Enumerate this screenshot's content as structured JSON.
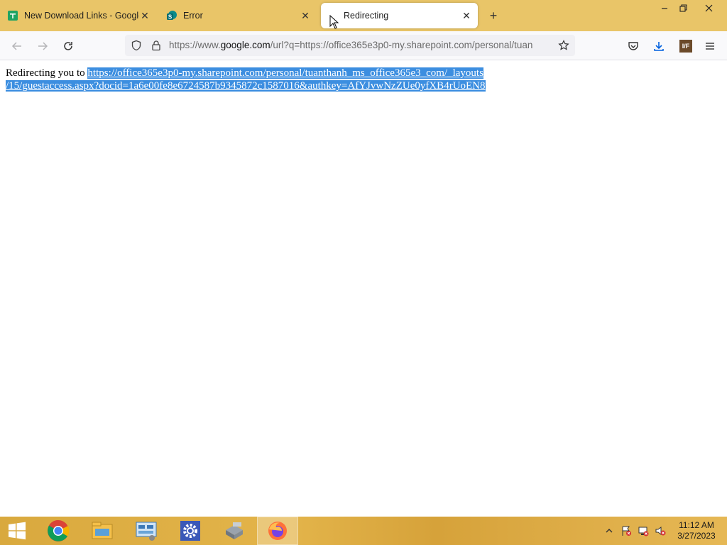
{
  "browser": {
    "tabs": [
      {
        "title": "New Download Links - Google ",
        "icon": "google-sheets-icon"
      },
      {
        "title": "Error",
        "icon": "sharepoint-icon"
      },
      {
        "title": "Redirecting",
        "icon": "blank-page-icon",
        "active": true
      }
    ],
    "address": {
      "prefix": "https://www.",
      "domain": "google.com",
      "rest": "/url?q=https://office365e3p0-my.sharepoint.com/personal/tuan"
    },
    "extension_badge": "I/F"
  },
  "page": {
    "intro": "Redirecting you to ",
    "link_line1": "https://office365e3p0-my.sharepoint.com/personal/tuanthanh_ms_office365e3_com/_layouts",
    "link_line2": "/15/guestaccess.aspx?docid=1a6e00fe8e6724587b9345872c1587016&authkey=AfYJvwNzZUe0yfXB4rUoEN8"
  },
  "taskbar": {
    "items": [
      "windows-start-icon",
      "chrome-icon",
      "file-explorer-icon",
      "network-app-icon",
      "settings-gear-icon",
      "storage-app-icon",
      "firefox-icon"
    ],
    "time": "11:12 AM",
    "date": "3/27/2023"
  },
  "colors": {
    "tabstrip": "#e9c568",
    "selection": "#3c8ee0",
    "taskbar": "#e0b04a"
  }
}
